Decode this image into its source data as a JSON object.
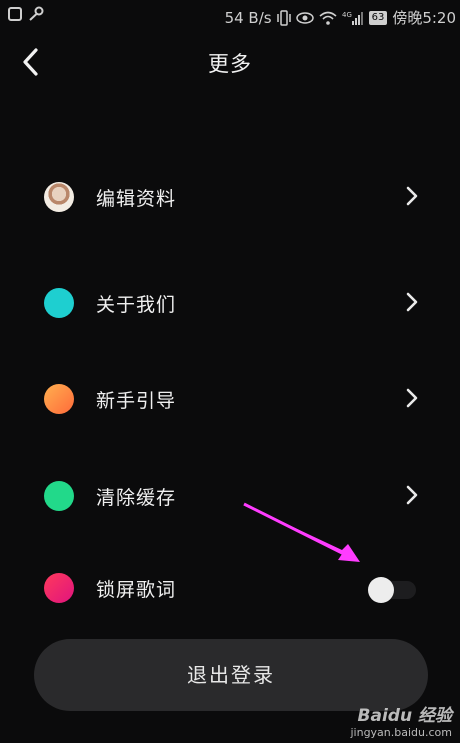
{
  "status_bar": {
    "net_speed": "54 B/s",
    "signal_label": "4G",
    "battery": "63",
    "time": "傍晚5:20"
  },
  "header": {
    "title": "更多"
  },
  "menu": [
    {
      "label": "编辑资料",
      "icon": "avatar-icon",
      "color": "#c9b6a0"
    },
    {
      "label": "关于我们",
      "icon": "teal-dot-icon",
      "color": "#1ecfd0"
    },
    {
      "label": "新手引导",
      "icon": "orange-dot-icon",
      "color": "#ff8a3d"
    },
    {
      "label": "清除缓存",
      "icon": "green-dot-icon",
      "color": "#22d98a"
    },
    {
      "label": "锁屏歌词",
      "icon": "pink-dot-icon",
      "color": "#f0246e",
      "toggle": false
    }
  ],
  "logout_label": "退出登录",
  "watermark": {
    "logo": "Baidu 经验",
    "url": "jingyan.baidu.com"
  },
  "colors": {
    "background": "#0b0b0c",
    "button": "#2a2a2c",
    "annotation_arrow": "#ff3cff"
  }
}
